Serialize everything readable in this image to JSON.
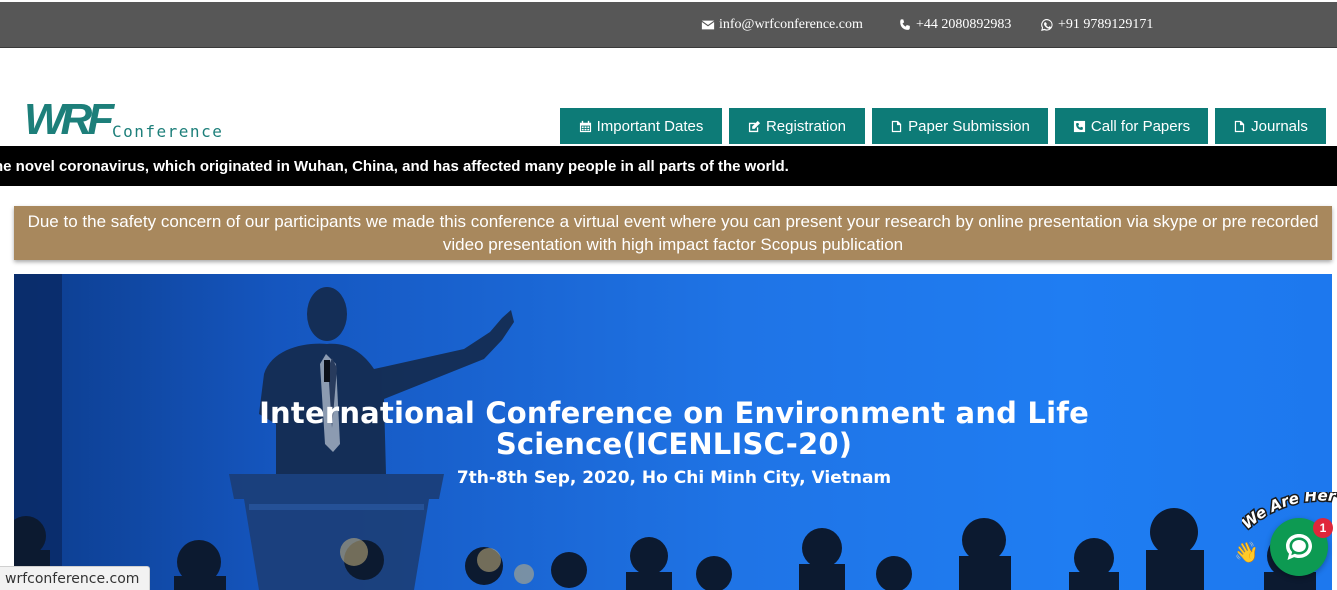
{
  "contact": {
    "email": "info@wrfconference.com",
    "phone": "+44 2080892983",
    "whatsapp": "+91 9789129171"
  },
  "logo": {
    "mark": "WRF",
    "word": "Conference"
  },
  "nav": [
    {
      "label": "Important Dates",
      "icon": "calendar-icon"
    },
    {
      "label": "Registration",
      "icon": "edit-icon"
    },
    {
      "label": "Paper Submission",
      "icon": "file-icon"
    },
    {
      "label": "Call for Papers",
      "icon": "phone-square-icon"
    },
    {
      "label": "Journals",
      "icon": "file-icon"
    }
  ],
  "ticker": {
    "text": "ne novel coronavirus, which originated in Wuhan, China, and has affected many people in all parts of the world."
  },
  "notice": {
    "text": "Due to the safety concern of our participants we made this conference a virtual event where you can present your research by online presentation via skype or pre recorded video presentation with high impact factor Scopus publication"
  },
  "hero": {
    "title": "International Conference on Environment and Life Science(ICENLISC-20)",
    "date_location": "7th-8th Sep, 2020, Ho Chi Minh City, Vietnam"
  },
  "status": {
    "url": "wrfconference.com"
  },
  "chat": {
    "label": "We Are Here!",
    "badge": "1",
    "colors": {
      "button": "#0d9a52",
      "badge": "#e0263a"
    }
  },
  "colors": {
    "topbar": "#575757",
    "nav": "#0d7b77",
    "ticker": "#000000",
    "notice": "#a8885d",
    "hero": "#1f7df2"
  }
}
